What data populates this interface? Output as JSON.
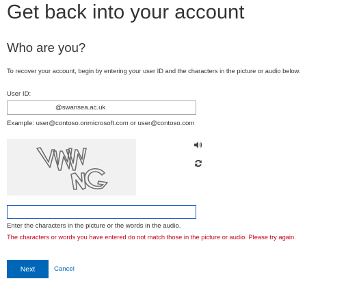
{
  "header": {
    "title": "Get back into your account",
    "subtitle": "Who are you?"
  },
  "instructions": "To recover your account, begin by entering your user ID and the characters in the picture or audio below.",
  "user_id": {
    "label": "User ID:",
    "value": "@swansea.ac.uk",
    "example": "Example: user@contoso.onmicrosoft.com or user@contoso.com"
  },
  "captcha": {
    "image_text": "VNNG",
    "audio_icon": "speaker-icon",
    "refresh_icon": "refresh-icon"
  },
  "answer": {
    "value": "",
    "hint": "Enter the characters in the picture or the words in the audio."
  },
  "error_message": "The characters or words you have entered do not match those in the picture or audio. Please try again.",
  "actions": {
    "next_label": "Next",
    "cancel_label": "Cancel"
  },
  "colors": {
    "primary": "#0067b8",
    "error": "#c1001c",
    "input_focus_border": "#1e62c7",
    "text": "#333333"
  }
}
